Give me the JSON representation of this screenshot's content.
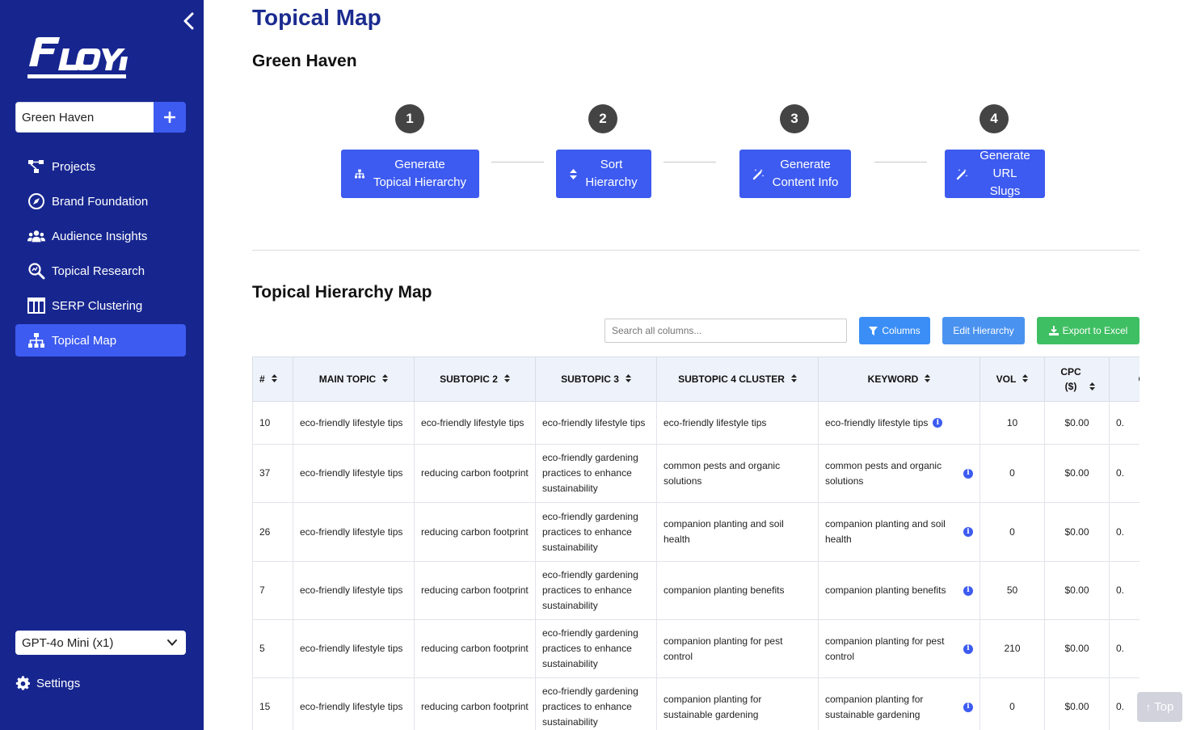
{
  "sidebar": {
    "logo_text": "FLOYI",
    "project_value": "Green Haven",
    "nav": [
      {
        "label": "Projects",
        "icon": "sitemap-icon"
      },
      {
        "label": "Brand Foundation",
        "icon": "compass-icon"
      },
      {
        "label": "Audience Insights",
        "icon": "users-icon"
      },
      {
        "label": "Topical Research",
        "icon": "search-magnify-icon"
      },
      {
        "label": "SERP Clustering",
        "icon": "columns-icon"
      },
      {
        "label": "Topical Map",
        "icon": "hierarchy-icon"
      }
    ],
    "model": "GPT-4o Mini (x1)",
    "settings": "Settings"
  },
  "main": {
    "title": "Topical Map",
    "project": "Green Haven",
    "steps": [
      {
        "num": "1",
        "line1": "Generate",
        "line2": "Topical Hierarchy"
      },
      {
        "num": "2",
        "line1": "Sort",
        "line2": "Hierarchy"
      },
      {
        "num": "3",
        "line1": "Generate",
        "line2": "Content Info"
      },
      {
        "num": "4",
        "line1": "Generate",
        "line2": "URL Slugs"
      }
    ],
    "section_title": "Topical Hierarchy Map",
    "search_placeholder": "Search all columns...",
    "columns_btn": "Columns",
    "edit_btn": "Edit Hierarchy",
    "export_btn": "Export to Excel",
    "top_btn": "Top"
  },
  "table": {
    "headers": [
      "#",
      "MAIN TOPIC",
      "SUBTOPIC 2",
      "SUBTOPIC 3",
      "SUBTOPIC 4 CLUSTER",
      "KEYWORD",
      "VOL",
      "CPC ($)",
      "COM"
    ],
    "rows": [
      [
        "10",
        "eco-friendly lifestyle tips",
        "eco-friendly lifestyle tips",
        "eco-friendly lifestyle tips",
        "eco-friendly lifestyle tips",
        "eco-friendly lifestyle tips",
        "10",
        "$0.00",
        "0."
      ],
      [
        "37",
        "eco-friendly lifestyle tips",
        "reducing carbon footprint",
        "eco-friendly gardening practices to enhance sustainability",
        "common pests and organic solutions",
        "common pests and organic solutions",
        "0",
        "$0.00",
        "0."
      ],
      [
        "26",
        "eco-friendly lifestyle tips",
        "reducing carbon footprint",
        "eco-friendly gardening practices to enhance sustainability",
        "companion planting and soil health",
        "companion planting and soil health",
        "0",
        "$0.00",
        "0."
      ],
      [
        "7",
        "eco-friendly lifestyle tips",
        "reducing carbon footprint",
        "eco-friendly gardening practices to enhance sustainability",
        "companion planting benefits",
        "companion planting benefits",
        "50",
        "$0.00",
        "0."
      ],
      [
        "5",
        "eco-friendly lifestyle tips",
        "reducing carbon footprint",
        "eco-friendly gardening practices to enhance sustainability",
        "companion planting for pest control",
        "companion planting for pest control",
        "210",
        "$0.00",
        "0."
      ],
      [
        "15",
        "eco-friendly lifestyle tips",
        "reducing carbon footprint",
        "eco-friendly gardening practices to enhance sustainability",
        "companion planting for sustainable gardening",
        "companion planting for sustainable gardening",
        "0",
        "$0.00",
        "0."
      ]
    ]
  },
  "colors": {
    "sidebar_bg": "#17268f",
    "accent": "#3d5bf0",
    "title": "#1b2b8f",
    "columns_btn": "#3a8ef6",
    "edit_btn": "#4a92f0",
    "export_btn": "#3fbf63"
  }
}
